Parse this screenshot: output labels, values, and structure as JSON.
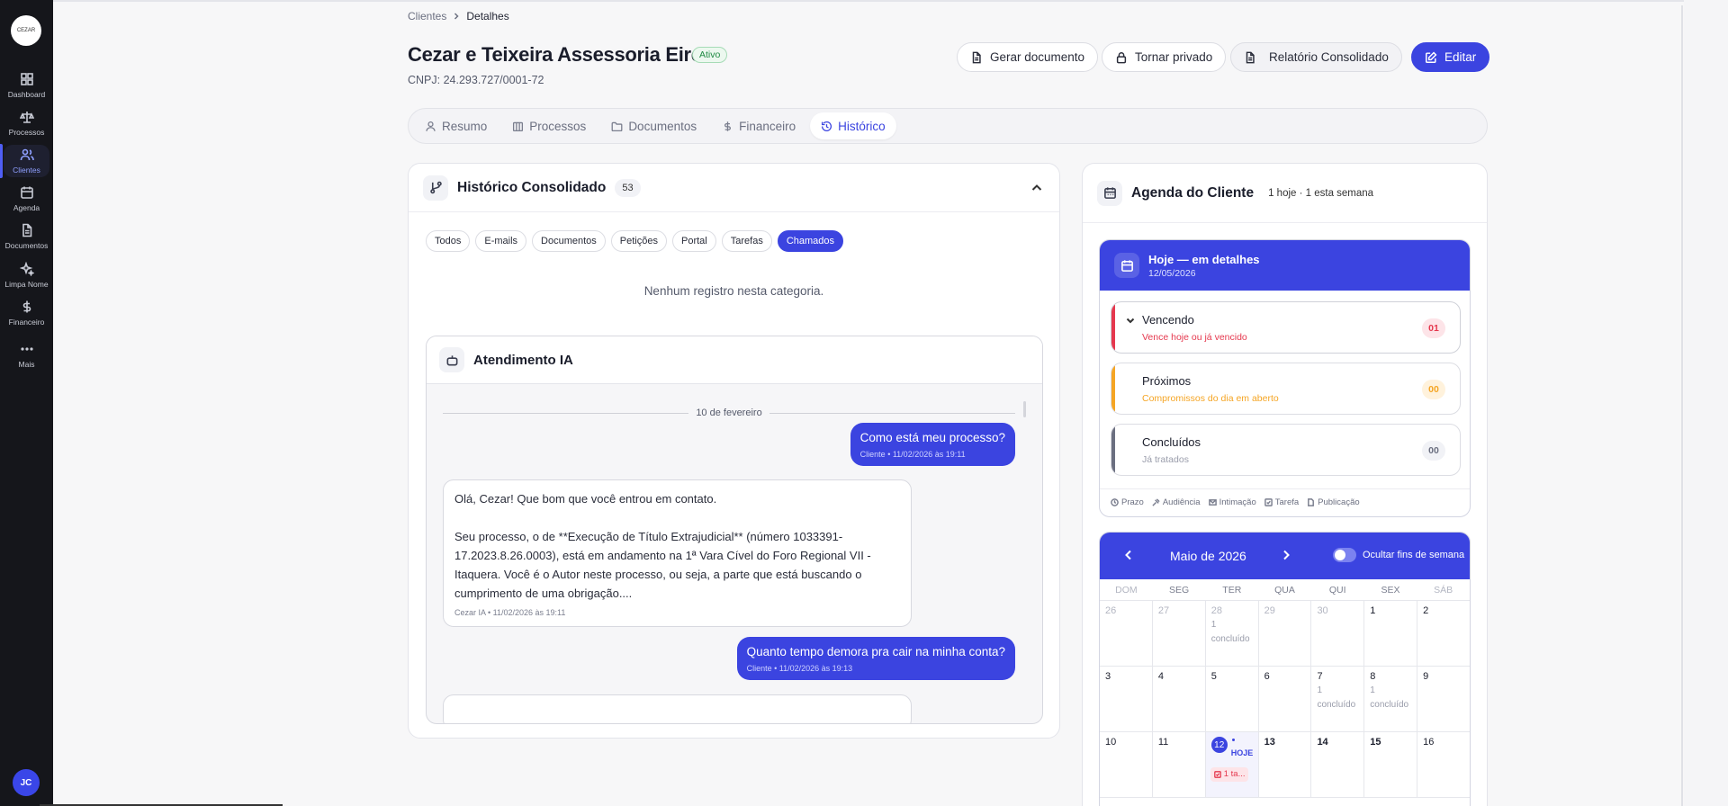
{
  "sidebar": {
    "logo_text": "CEZAR",
    "items": [
      {
        "label": "Dashboard",
        "icon": "grid-icon"
      },
      {
        "label": "Processos",
        "icon": "scale-icon"
      },
      {
        "label": "Clientes",
        "icon": "users-icon"
      },
      {
        "label": "Agenda",
        "icon": "calendar-icon"
      },
      {
        "label": "Documentos",
        "icon": "file-icon"
      },
      {
        "label": "Limpa Nome",
        "icon": "sparkle-icon"
      },
      {
        "label": "Financeiro",
        "icon": "dollar-icon"
      },
      {
        "label": "Mais",
        "icon": "more-icon"
      }
    ],
    "active_index": 2,
    "user_initials": "JC"
  },
  "breadcrumb": {
    "parent": "Clientes",
    "current": "Detalhes"
  },
  "client": {
    "name": "Cezar e Teixeira Assessoria Eireli",
    "status": "Ativo",
    "cnpj": "CNPJ: 24.293.727/0001-72"
  },
  "actions": {
    "generate_doc": "Gerar documento",
    "make_private": "Tornar privado",
    "report": "Relatório Consolidado",
    "edit": "Editar"
  },
  "tabs": [
    "Resumo",
    "Processos",
    "Documentos",
    "Financeiro",
    "Histórico"
  ],
  "active_tab": "Histórico",
  "history": {
    "title": "Histórico Consolidado",
    "count": "53",
    "filters": [
      "Todos",
      "E-mails",
      "Documentos",
      "Petições",
      "Portal",
      "Tarefas",
      "Chamados"
    ],
    "active_filter": "Chamados",
    "empty_text": "Nenhum registro nesta categoria."
  },
  "chat": {
    "title": "Atendimento IA",
    "date_separator": "10 de fevereiro",
    "messages": [
      {
        "from": "client",
        "text": "Como está meu processo?",
        "meta": "Cliente • 11/02/2026 às 19:11"
      },
      {
        "from": "ai",
        "text_1": "Olá, Cezar! Que bom que você entrou em contato.",
        "text_2": "Seu processo, o de **Execução de Título Extrajudicial** (número 1033391-17.2023.8.26.0003), está em andamento na 1ª Vara Cível do Foro Regional VII - Itaquera. Você é o Autor neste processo, ou seja, a parte que está buscando o cumprimento de uma obrigação....",
        "meta": "Cezar IA • 11/02/2026 às 19:11"
      },
      {
        "from": "client",
        "text": "Quanto tempo demora pra cair na minha conta?",
        "meta": "Cliente • 11/02/2026 às 19:13"
      }
    ]
  },
  "agenda": {
    "title": "Agenda do Cliente",
    "subtitle": "1 hoje · 1 esta semana",
    "today": {
      "title": "Hoje — em detalhes",
      "date": "12/05/2026"
    },
    "sections": [
      {
        "title": "Vencendo",
        "subtitle": "Vence hoje ou já vencido",
        "count": "01",
        "color": "#e5384e"
      },
      {
        "title": "Próximos",
        "subtitle": "Compromissos do dia em aberto",
        "count": "00",
        "color": "#f5a524"
      },
      {
        "title": "Concluídos",
        "subtitle": "Já tratados",
        "count": "00",
        "color": "#6b6f80"
      }
    ],
    "legend": [
      "Prazo",
      "Audiência",
      "Intimação",
      "Tarefa",
      "Publicação"
    ],
    "calendar": {
      "month": "Maio de 2026",
      "hide_weekends_label": "Ocultar fins de semana",
      "weekdays": [
        "DOM",
        "SEG",
        "TER",
        "QUA",
        "QUI",
        "SEX",
        "SÁB"
      ],
      "today_label": "HOJE",
      "task_label": "1 ta...",
      "done_label": "1 concluído",
      "weeks": [
        [
          "26",
          "27",
          "28",
          "29",
          "30",
          "1",
          "2"
        ],
        [
          "3",
          "4",
          "5",
          "6",
          "7",
          "8",
          "9"
        ],
        [
          "10",
          "11",
          "12",
          "13",
          "14",
          "15",
          "16"
        ]
      ]
    }
  },
  "colors": {
    "primary": "#3b44e0",
    "sidebar_bg": "#15161b",
    "danger": "#e5384e",
    "warning": "#f5a524",
    "success": "#1f8a43"
  }
}
